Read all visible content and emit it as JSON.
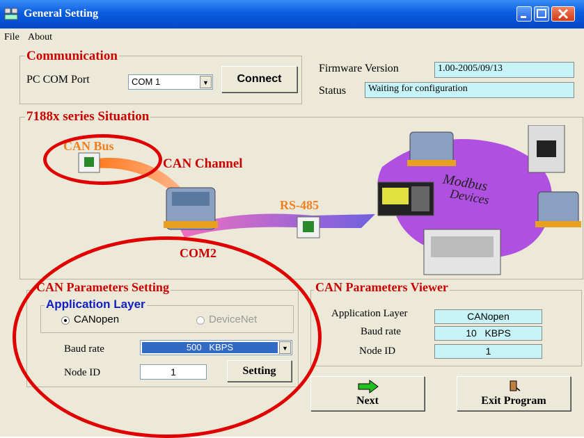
{
  "window": {
    "title": "General Setting"
  },
  "menu": {
    "file": "File",
    "about": "About"
  },
  "communication": {
    "title": "Communication",
    "com_label": "PC COM Port",
    "com_value": "COM 1",
    "connect_label": "Connect"
  },
  "firmware": {
    "label": "Firmware Version",
    "value": "1.00-2005/09/13"
  },
  "status": {
    "label": "Status",
    "value": "Waiting for configuration"
  },
  "situation": {
    "title": "7188x series Situation",
    "can_bus": "CAN Bus",
    "can_channel": "CAN Channel",
    "rs485": "RS-485",
    "com2": "COM2",
    "modbus_line1": "Modbus",
    "modbus_line2": "Devices"
  },
  "can_setting": {
    "title": "CAN Parameters Setting",
    "app_layer_title": "Application Layer",
    "canopen": "CANopen",
    "devicenet": "DeviceNet",
    "baud_label": "Baud rate",
    "baud_value": "500   KBPS",
    "node_label": "Node ID",
    "node_value": "1",
    "setting_button": "Setting"
  },
  "can_viewer": {
    "title": "CAN Parameters Viewer",
    "app_layer_label": "Application Layer",
    "app_layer_value": "CANopen",
    "baud_label": "Baud rate",
    "baud_value": "10   KBPS",
    "node_label": "Node ID",
    "node_value": "1"
  },
  "buttons": {
    "next": "Next",
    "exit": "Exit Program"
  },
  "colors": {
    "accent_red": "#e00000",
    "title_blue": "#0a5de0",
    "field_cyan": "#c6f4f8",
    "group_title_red": "#cc0000"
  }
}
